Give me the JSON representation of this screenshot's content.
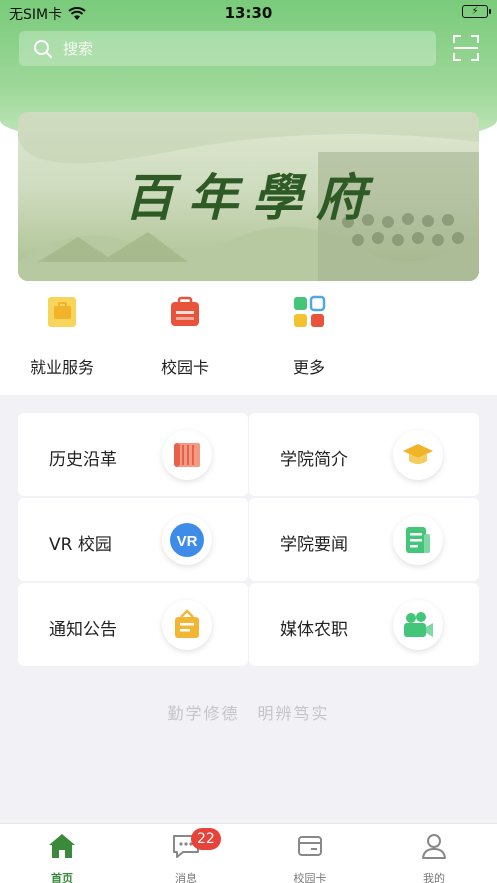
{
  "status_bar": {
    "carrier": "无SIM卡",
    "time": "13:30"
  },
  "search": {
    "placeholder": "搜索"
  },
  "banner": {
    "title": "百年學府"
  },
  "quick_actions": [
    {
      "label": "就业服务",
      "icon": "briefcase-icon",
      "color": "#f2c230"
    },
    {
      "label": "校园卡",
      "icon": "card-wallet-icon",
      "color": "#e8533b"
    },
    {
      "label": "更多",
      "icon": "grid-more-icon",
      "color": "#4fa9e0"
    }
  ],
  "grid": [
    {
      "label": "历史沿革",
      "icon": "scroll-icon",
      "color": "#e8614a"
    },
    {
      "label": "学院简介",
      "icon": "graduation-cap-icon",
      "color": "#f0b427"
    },
    {
      "label": "VR 校园",
      "icon": "vr-icon",
      "color": "#3f8ce8"
    },
    {
      "label": "学院要闻",
      "icon": "news-icon",
      "color": "#43c57a"
    },
    {
      "label": "通知公告",
      "icon": "notice-board-icon",
      "color": "#f2b634"
    },
    {
      "label": "媒体农职",
      "icon": "video-camera-icon",
      "color": "#43c57a"
    }
  ],
  "motto": "勤学修德　明辨笃实",
  "tab_bar": {
    "items": [
      {
        "label": "首页",
        "icon": "home-icon",
        "active": true
      },
      {
        "label": "消息",
        "icon": "message-icon",
        "badge": "22"
      },
      {
        "label": "校园卡",
        "icon": "campus-card-icon"
      },
      {
        "label": "我的",
        "icon": "user-icon"
      }
    ]
  },
  "colors": {
    "accent": "#3b8a3c",
    "header_green": "#79cb7b",
    "badge": "#e8433a"
  }
}
